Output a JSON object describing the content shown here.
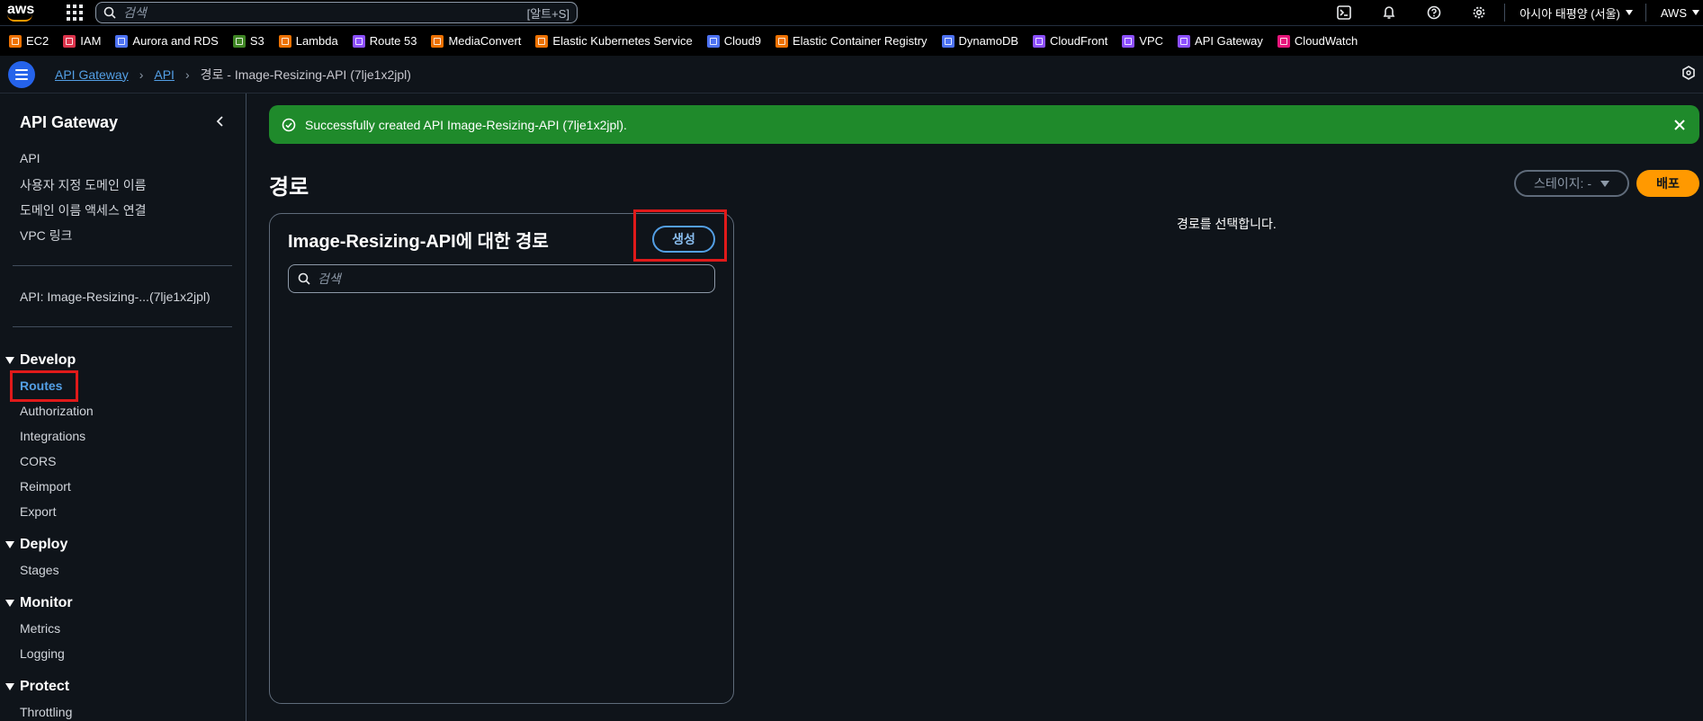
{
  "topnav": {
    "logo_text": "aws",
    "search_placeholder": "검색",
    "search_shortcut": "[알트+S]",
    "region": "아시아 태평양 (서울)",
    "account": "AWS",
    "icons": [
      "cloudshell-icon",
      "bell-icon",
      "help-icon",
      "gear-icon"
    ]
  },
  "favorites": [
    {
      "label": "EC2",
      "color": "#ed7100"
    },
    {
      "label": "IAM",
      "color": "#dd344c"
    },
    {
      "label": "Aurora and RDS",
      "color": "#4d72f3"
    },
    {
      "label": "S3",
      "color": "#3f8624"
    },
    {
      "label": "Lambda",
      "color": "#ed7100"
    },
    {
      "label": "Route 53",
      "color": "#8c4fff"
    },
    {
      "label": "MediaConvert",
      "color": "#ed7100"
    },
    {
      "label": "Elastic Kubernetes Service",
      "color": "#ed7100"
    },
    {
      "label": "Cloud9",
      "color": "#4d72f3"
    },
    {
      "label": "Elastic Container Registry",
      "color": "#ed7100"
    },
    {
      "label": "DynamoDB",
      "color": "#4d72f3"
    },
    {
      "label": "CloudFront",
      "color": "#8c4fff"
    },
    {
      "label": "VPC",
      "color": "#8c4fff"
    },
    {
      "label": "API Gateway",
      "color": "#8c4fff"
    },
    {
      "label": "CloudWatch",
      "color": "#e7157b"
    }
  ],
  "breadcrumb": {
    "items": [
      "API Gateway",
      "API"
    ],
    "current": "경로 - Image-Resizing-API (7lje1x2jpl)"
  },
  "sidebar": {
    "title": "API Gateway",
    "top_items": [
      "API",
      "사용자 지정 도메인 이름",
      "도메인 이름 액세스 연결",
      "VPC 링크"
    ],
    "api_item": "API: Image-Resizing-...(7lje1x2jpl)",
    "sections": [
      {
        "label": "Develop",
        "items": [
          "Routes",
          "Authorization",
          "Integrations",
          "CORS",
          "Reimport",
          "Export"
        ]
      },
      {
        "label": "Deploy",
        "items": [
          "Stages"
        ]
      },
      {
        "label": "Monitor",
        "items": [
          "Metrics",
          "Logging"
        ]
      },
      {
        "label": "Protect",
        "items": [
          "Throttling"
        ]
      }
    ]
  },
  "flash": {
    "message": "Successfully created API Image-Resizing-API (7lje1x2jpl).",
    "color": "#1f8a2b"
  },
  "main": {
    "heading": "경로",
    "stage_label": "스테이지: -",
    "deploy_label": "배포",
    "panel_title": "Image-Resizing-API에 대한 경로",
    "create_label": "생성",
    "search_placeholder": "검색",
    "select_message": "경로를 선택합니다."
  },
  "colors": {
    "accent": "#539fe5",
    "deploy": "#ff9900",
    "highlight": "#e01a1a"
  }
}
